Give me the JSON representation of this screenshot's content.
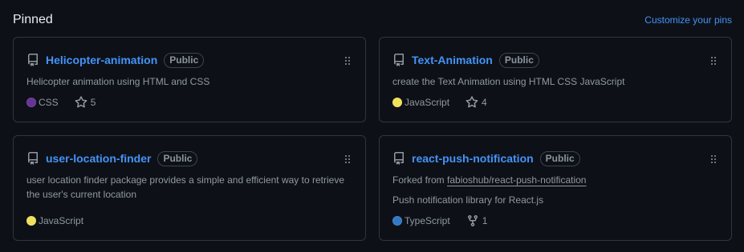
{
  "header": {
    "title": "Pinned",
    "customize_label": "Customize your pins"
  },
  "cards": [
    {
      "name": "Helicopter-animation",
      "visibility": "Public",
      "description": "Helicopter animation using HTML and CSS",
      "language": "CSS",
      "language_color": "#663399",
      "stars": "5"
    },
    {
      "name": "Text-Animation",
      "visibility": "Public",
      "description": "create the Text Animation using HTML CSS JavaScript",
      "language": "JavaScript",
      "language_color": "#f1e05a",
      "stars": "4"
    },
    {
      "name": "user-location-finder",
      "visibility": "Public",
      "description": "user location finder package provides a simple and efficient way to retrieve the user's current location",
      "language": "JavaScript",
      "language_color": "#f1e05a"
    },
    {
      "name": "react-push-notification",
      "visibility": "Public",
      "forked_prefix": "Forked from",
      "forked_from": "fabioshub/react-push-notification",
      "description": "Push notification library for React.js",
      "language": "TypeScript",
      "language_color": "#3178c6",
      "forks": "1"
    }
  ]
}
